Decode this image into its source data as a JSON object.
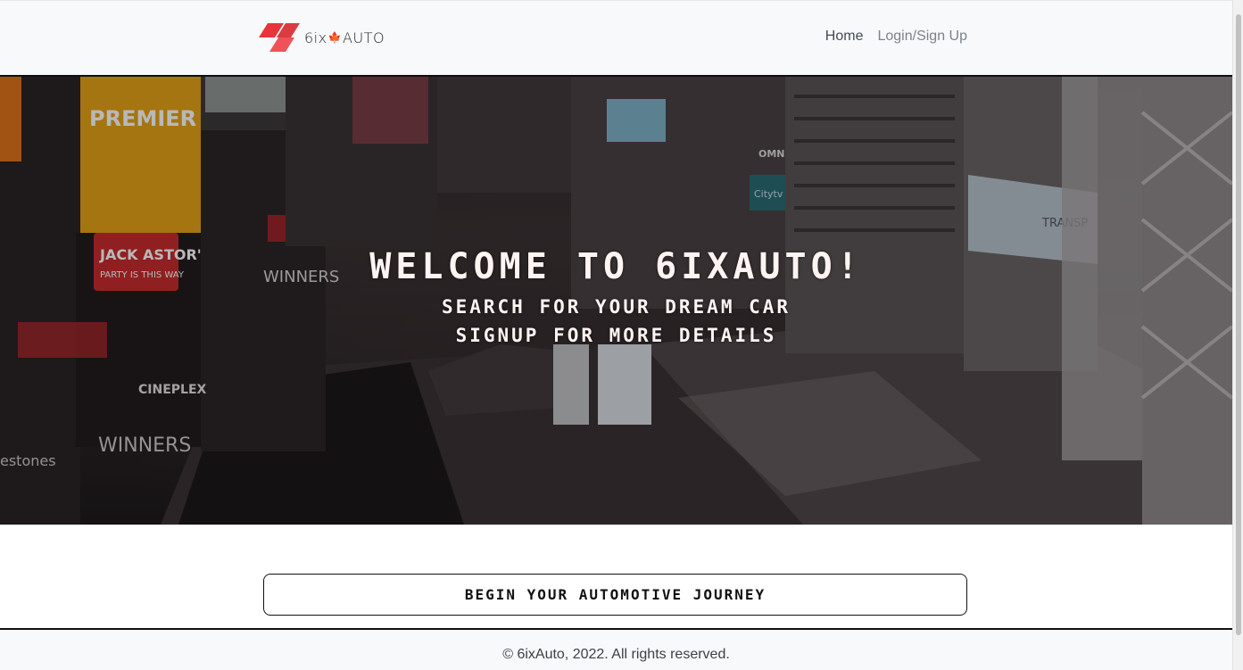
{
  "header": {
    "logo": {
      "prefix": "6ix",
      "leaf_icon": "maple-leaf-icon",
      "suffix": "AUTO"
    },
    "nav": {
      "home_label": "Home",
      "login_label": "Login/Sign Up"
    }
  },
  "hero": {
    "title": "WELCOME TO 6IXAUTO!",
    "subtitle_line1": "SEARCH FOR YOUR DREAM CAR",
    "subtitle_line2": "SIGNUP FOR MORE DETAILS",
    "sign_texts": {
      "premier": "PREMIER OU",
      "jack_astors": "JACK ASTOR'S",
      "party": "PARTY IS THIS WAY",
      "winners_top": "WINNERS",
      "cineplex": "CINEPLEX",
      "winners_bottom": "WINNERS",
      "keg": "estones",
      "omni": "OMNI",
      "transp": "TRANSP",
      "city": "Citytv"
    }
  },
  "cta": {
    "label": "BEGIN YOUR AUTOMOTIVE JOURNEY"
  },
  "footer": {
    "copyright": "© 6ixAuto, 2022. All rights reserved."
  },
  "colors": {
    "brand_red": "#e8343a",
    "nav_bg": "#f8f9fa",
    "hero_text": "#fff4f2"
  }
}
